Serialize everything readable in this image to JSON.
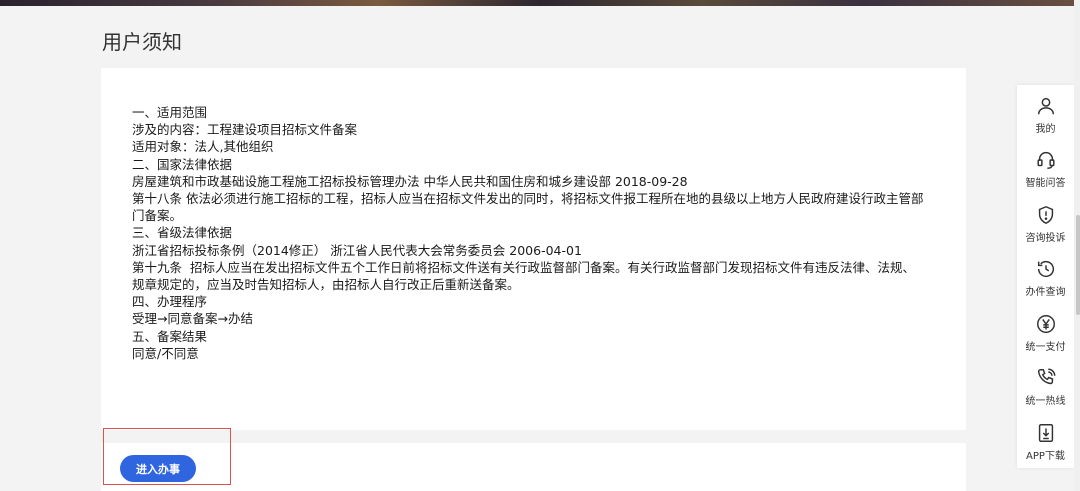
{
  "page": {
    "title": "用户须知"
  },
  "notice": {
    "lines": [
      "一、适用范围",
      "涉及的内容：工程建设项目招标文件备案",
      "适用对象：法人,其他组织",
      "二、国家法律依据",
      "房屋建筑和市政基础设施工程施工招标投标管理办法 中华人民共和国住房和城乡建设部 2018-09-28",
      "第十八条 依法必须进行施工招标的工程，招标人应当在招标文件发出的同时，将招标文件报工程所在地的县级以上地方人民政府建设行政主管部",
      "门备案。",
      "三、省级法律依据",
      "浙江省招标投标条例（2014修正） 浙江省人民代表大会常务委员会 2006-04-01",
      "第十九条  招标人应当在发出招标文件五个工作日前将招标文件送有关行政监督部门备案。有关行政监督部门发现招标文件有违反法律、法规、",
      "规章规定的，应当及时告知招标人，由招标人自行改正后重新送备案。",
      "四、办理程序",
      "受理→同意备案→办结",
      "五、备案结果",
      "同意/不同意"
    ]
  },
  "actions": {
    "enter_label": "进入办事"
  },
  "sidebar": {
    "items": [
      {
        "label": "我的",
        "icon": "user-icon"
      },
      {
        "label": "智能问答",
        "icon": "headset-icon"
      },
      {
        "label": "咨询投诉",
        "icon": "shield-alert-icon"
      },
      {
        "label": "办件查询",
        "icon": "history-icon"
      },
      {
        "label": "统一支付",
        "icon": "yen-icon"
      },
      {
        "label": "统一热线",
        "icon": "phone-icon"
      },
      {
        "label": "APP下载",
        "icon": "download-icon"
      }
    ]
  },
  "colors": {
    "primary": "#2f66e0",
    "highlight_border": "#d9534f",
    "background": "#f3f3f3"
  }
}
